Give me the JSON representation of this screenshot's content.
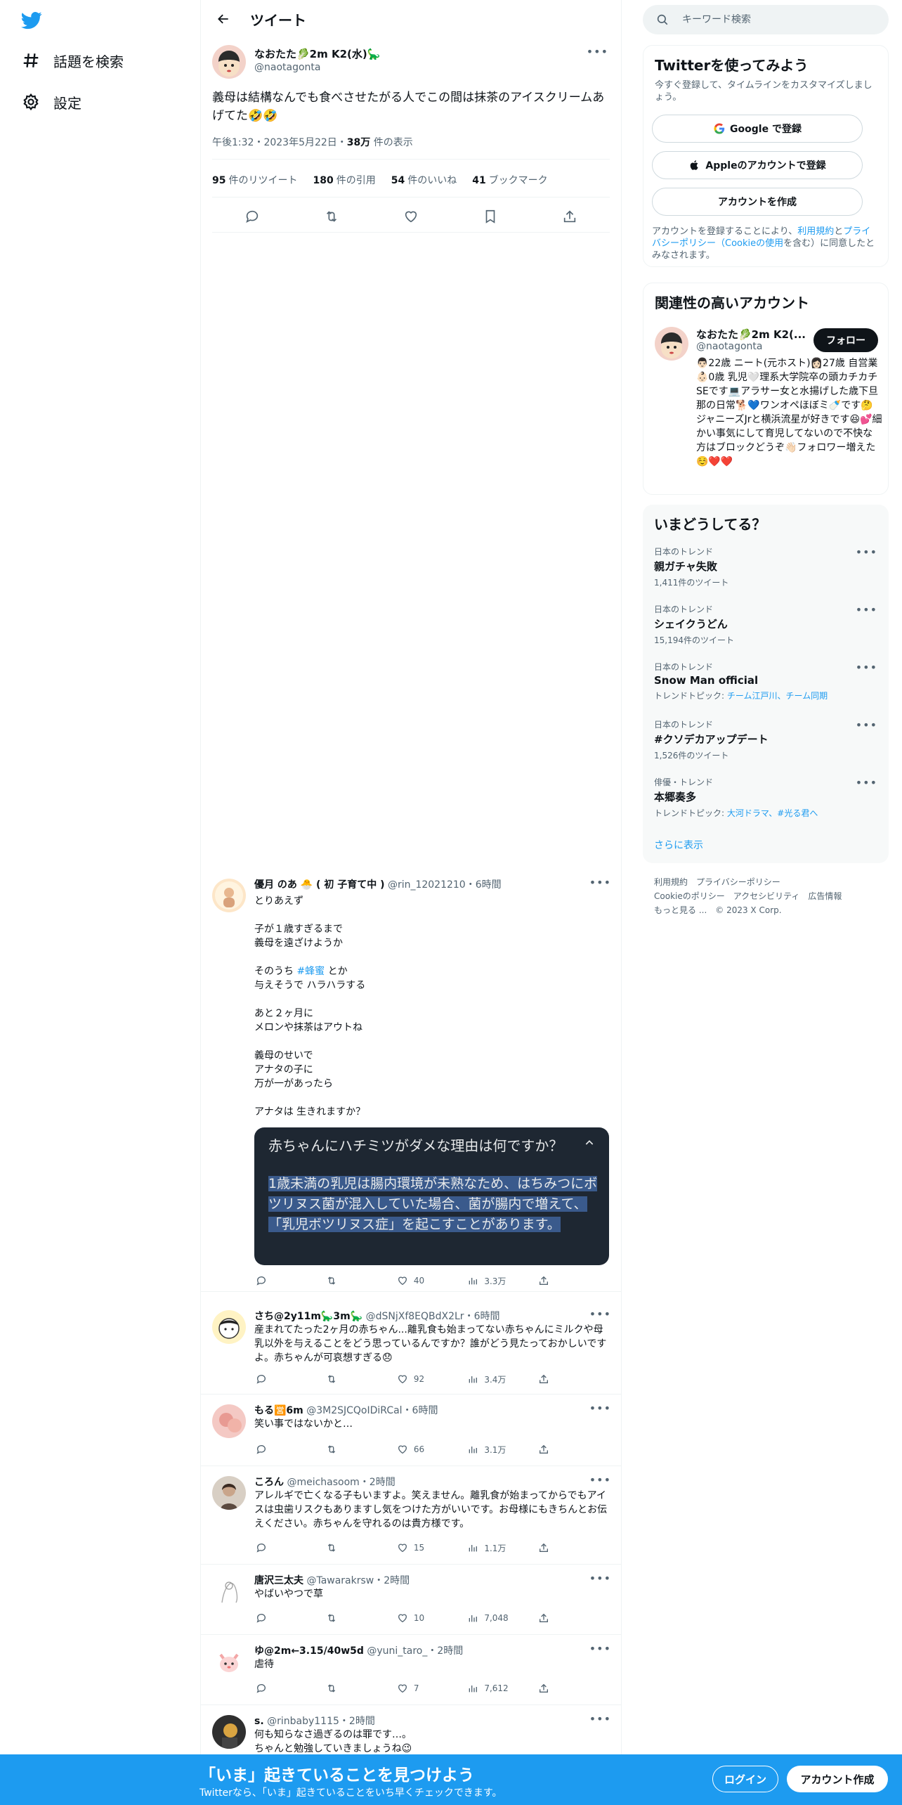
{
  "nav": {
    "explore_label": "話題を検索",
    "settings_label": "設定"
  },
  "header": {
    "title": "ツイート"
  },
  "focal_tweet": {
    "name": "なおたた🥬2m K2(水)🦕",
    "handle": "@naotagonta",
    "text": "義母は結構なんでも食べさせたがる人でこの間は抹茶のアイスクリームあげてた🤣🤣",
    "time": "午後1:32・2023年5月22日・",
    "views": "38万",
    "views_label": "件の表示",
    "stats": {
      "retweets": "95",
      "retweets_label": "件のリツイート",
      "quotes": "180",
      "quotes_label": "件の引用",
      "likes": "54",
      "likes_label": "件のいいね",
      "bookmarks": "41",
      "bookmarks_label": "ブックマーク"
    }
  },
  "replies": [
    {
      "name": "優月 のあ 🐣 ( 初 子育て中 )",
      "handle": "@rin_12021210",
      "time": "・6時間",
      "body_a": "とりあえず\n\n子が１歳すぎるまで\n義母を遠ざけようか\n\nそのうち ",
      "hashtag": "#蜂蜜",
      "body_b": " とか\n与えそうで ハラハラする\n\nあと２ヶ月に\nメロンや抹茶はアウトね\n\n義母のせいで\nアナタの子に\n万が一があったら\n\nアナタは 生きれますか？",
      "note_question": "赤ちゃんにハチミツがダメな理由は何ですか？",
      "note_answer": "1歳未満の乳児は腸内環境が未熟なため、はちみつにボツリヌス菌が混入していた場合、菌が腸内で増えて、「乳児ボツリヌス症」を起こすことがあります。",
      "likes": "40",
      "views": "3.3万"
    },
    {
      "name": "さち@2y11m🦕3m🦕",
      "handle": "@dSNjXf8EQBdX2Lr",
      "time": "・6時間",
      "body": "産まれてたった2ヶ月の赤ちゃん...離乳食も始まってない赤ちゃんにミルクや母乳以外を与えることをどう思っているんですか？誰がどう見たっておかしいですよ。赤ちゃんが可哀想すぎる😞",
      "likes": "92",
      "views": "3.4万"
    },
    {
      "name": "もる🈺6m",
      "handle": "@3M2SJCQoIDiRCal",
      "time": "・6時間",
      "body": "笑い事ではないかと…",
      "likes": "66",
      "views": "3.1万"
    },
    {
      "name": "ころん",
      "handle": "@meichasoom",
      "time": "・2時間",
      "body": "アレルギで亡くなる子もいますよ。笑えません。離乳食が始まってからでもアイスは虫歯リスクもありますし気をつけた方がいいです。お母様にもきちんとお伝えください。赤ちゃんを守れるのは貴方様です。",
      "likes": "15",
      "views": "1.1万"
    },
    {
      "name": "唐沢三太夫",
      "handle": "@Tawarakrsw",
      "time": "・2時間",
      "body": "やばいやつで草",
      "likes": "10",
      "views": "7,048"
    },
    {
      "name": "ゆ@2m←3.15/40w5d",
      "handle": "@yuni_taro_",
      "time": "・2時間",
      "body": "虐待",
      "likes": "7",
      "views": "7,612"
    },
    {
      "name": "s.",
      "handle": "@rinbaby1115",
      "time": "・2時間",
      "body": "何も知らなさ過ぎるのは罪です…。\nちゃんと勉強していきましょうね😉"
    }
  ],
  "search": {
    "placeholder": "キーワード検索"
  },
  "signup_card": {
    "title": "Twitterを使ってみよう",
    "subtitle": "今すぐ登録して、タイムラインをカスタマイズしましょう。",
    "google_label": "Google で登録",
    "apple_label": "Appleのアカウントで登録",
    "create_label": "アカウントを作成",
    "terms_a": "アカウントを登録することにより、",
    "terms_link1": "利用規約",
    "terms_b": "と",
    "terms_link2": "プライバシーポリシー（Cookieの使用",
    "terms_c": "を含む）に同意したとみなされます。"
  },
  "relevant": {
    "title": "関連性の高いアカウント",
    "name": "なおたた🥬2m K2(...",
    "handle": "@naotagonta",
    "follow_label": "フォロー",
    "bio": "👨🏻22歳 ニート(元ホスト)👩🏻27歳 自営業👶🏻0歳 乳児🤍理系大学院卒の頭カチカチSEです💻アラサー女と水揚げした歳下旦那の日常🐕💙ワンオペほぼミ🍼です🤔ジャニーズJrと横浜流星が好きです😆💕細かい事気にして育児してないので不快な方はブロックどうぞ👋🏻フォロワー増えた☺️❤️❤️"
  },
  "trends": {
    "title": "いまどうしてる？",
    "items": [
      {
        "context": "日本のトレンド",
        "name": "親ガチャ失敗",
        "count": "1,411件のツイート"
      },
      {
        "context": "日本のトレンド",
        "name": "シェイクうどん",
        "count": "15,194件のツイート"
      },
      {
        "context": "日本のトレンド",
        "name": "Snow Man official",
        "count_prefix": "トレンドトピック: ",
        "count_links": "チーム江戸川、チーム同期"
      },
      {
        "context": "日本のトレンド",
        "name": "#クソデカアップデート",
        "count": "1,526件のツイート"
      },
      {
        "context": "俳優・トレンド",
        "name": "本郷奏多",
        "count_prefix": "トレンドトピック: ",
        "count_links": "大河ドラマ、#光る君へ"
      }
    ],
    "show_more": "さらに表示"
  },
  "footer": {
    "tos": "利用規約",
    "privacy": "プライバシーポリシー",
    "cookie": "Cookieのポリシー",
    "accessibility": "アクセシビリティ",
    "ads": "広告情報",
    "more": "もっと見る ...",
    "copyright": "© 2023 X Corp."
  },
  "bottom_bar": {
    "headline": "「いま」起きていることを見つけよう",
    "subline": "Twitterなら、「いま」起きていることをいち早くチェックできます。",
    "login_label": "ログイン",
    "signup_label": "アカウント作成"
  },
  "colors": {
    "accent": "#1d9bf0",
    "text": "#0f1419",
    "muted": "#536471",
    "note_bg": "#1e2732"
  }
}
